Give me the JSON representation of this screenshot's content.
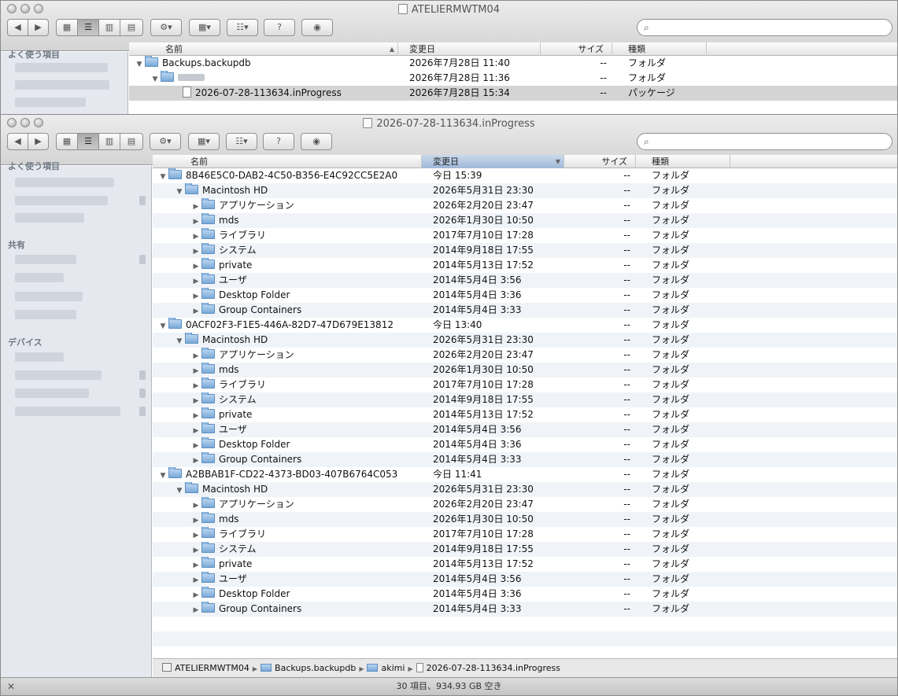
{
  "back_window": {
    "title": "ATELIERMWTM04",
    "sidebar": {
      "favorites_header": "よく使う項目"
    },
    "columns": {
      "name": "名前",
      "date": "変更日",
      "size": "サイズ",
      "kind": "種類"
    },
    "rows": [
      {
        "name": "Backups.backupdb",
        "date": "2026年7月28日 11:40",
        "size": "--",
        "kind": "フォルダ"
      },
      {
        "name": "",
        "date": "2026年7月28日 11:36",
        "size": "--",
        "kind": "フォルダ"
      },
      {
        "name": "2026-07-28-113634.inProgress",
        "date": "2026年7月28日 15:34",
        "size": "--",
        "kind": "パッケージ"
      }
    ]
  },
  "front_window": {
    "title": "2026-07-28-113634.inProgress",
    "sidebar": {
      "favorites_header": "よく使う項目",
      "shared_header": "共有",
      "devices_header": "デバイス"
    },
    "columns": {
      "name": "名前",
      "date": "変更日",
      "size": "サイズ",
      "kind": "種類"
    },
    "rows": [
      {
        "name": "8B46E5C0-DAB2-4C50-B356-E4C92CC5E2A0",
        "date": "今日 15:39",
        "size": "--",
        "kind": "フォルダ"
      },
      {
        "name": "Macintosh HD",
        "date": "2026年5月31日 23:30",
        "size": "--",
        "kind": "フォルダ"
      },
      {
        "name": "アプリケーション",
        "date": "2026年2月20日 23:47",
        "size": "--",
        "kind": "フォルダ"
      },
      {
        "name": "mds",
        "date": "2026年1月30日 10:50",
        "size": "--",
        "kind": "フォルダ"
      },
      {
        "name": "ライブラリ",
        "date": "2017年7月10日 17:28",
        "size": "--",
        "kind": "フォルダ"
      },
      {
        "name": "システム",
        "date": "2014年9月18日 17:55",
        "size": "--",
        "kind": "フォルダ"
      },
      {
        "name": "private",
        "date": "2014年5月13日 17:52",
        "size": "--",
        "kind": "フォルダ"
      },
      {
        "name": "ユーザ",
        "date": "2014年5月4日 3:56",
        "size": "--",
        "kind": "フォルダ"
      },
      {
        "name": "Desktop Folder",
        "date": "2014年5月4日 3:36",
        "size": "--",
        "kind": "フォルダ"
      },
      {
        "name": "Group Containers",
        "date": "2014年5月4日 3:33",
        "size": "--",
        "kind": "フォルダ"
      },
      {
        "name": "0ACF02F3-F1E5-446A-82D7-47D679E13812",
        "date": "今日 13:40",
        "size": "--",
        "kind": "フォルダ"
      },
      {
        "name": "Macintosh HD",
        "date": "2026年5月31日 23:30",
        "size": "--",
        "kind": "フォルダ"
      },
      {
        "name": "アプリケーション",
        "date": "2026年2月20日 23:47",
        "size": "--",
        "kind": "フォルダ"
      },
      {
        "name": "mds",
        "date": "2026年1月30日 10:50",
        "size": "--",
        "kind": "フォルダ"
      },
      {
        "name": "ライブラリ",
        "date": "2017年7月10日 17:28",
        "size": "--",
        "kind": "フォルダ"
      },
      {
        "name": "システム",
        "date": "2014年9月18日 17:55",
        "size": "--",
        "kind": "フォルダ"
      },
      {
        "name": "private",
        "date": "2014年5月13日 17:52",
        "size": "--",
        "kind": "フォルダ"
      },
      {
        "name": "ユーザ",
        "date": "2014年5月4日 3:56",
        "size": "--",
        "kind": "フォルダ"
      },
      {
        "name": "Desktop Folder",
        "date": "2014年5月4日 3:36",
        "size": "--",
        "kind": "フォルダ"
      },
      {
        "name": "Group Containers",
        "date": "2014年5月4日 3:33",
        "size": "--",
        "kind": "フォルダ"
      },
      {
        "name": "A2BBAB1F-CD22-4373-BD03-407B6764C053",
        "date": "今日 11:41",
        "size": "--",
        "kind": "フォルダ"
      },
      {
        "name": "Macintosh HD",
        "date": "2026年5月31日 23:30",
        "size": "--",
        "kind": "フォルダ"
      },
      {
        "name": "アプリケーション",
        "date": "2026年2月20日 23:47",
        "size": "--",
        "kind": "フォルダ"
      },
      {
        "name": "mds",
        "date": "2026年1月30日 10:50",
        "size": "--",
        "kind": "フォルダ"
      },
      {
        "name": "ライブラリ",
        "date": "2017年7月10日 17:28",
        "size": "--",
        "kind": "フォルダ"
      },
      {
        "name": "システム",
        "date": "2014年9月18日 17:55",
        "size": "--",
        "kind": "フォルダ"
      },
      {
        "name": "private",
        "date": "2014年5月13日 17:52",
        "size": "--",
        "kind": "フォルダ"
      },
      {
        "name": "ユーザ",
        "date": "2014年5月4日 3:56",
        "size": "--",
        "kind": "フォルダ"
      },
      {
        "name": "Desktop Folder",
        "date": "2014年5月4日 3:36",
        "size": "--",
        "kind": "フォルダ"
      },
      {
        "name": "Group Containers",
        "date": "2014年5月4日 3:33",
        "size": "--",
        "kind": "フォルダ"
      }
    ],
    "pathbar": [
      "ATELIERMWTM04",
      "Backups.backupdb",
      "akimi",
      "2026-07-28-113634.inProgress"
    ],
    "status": "30 項目、934.93 GB 空き"
  }
}
